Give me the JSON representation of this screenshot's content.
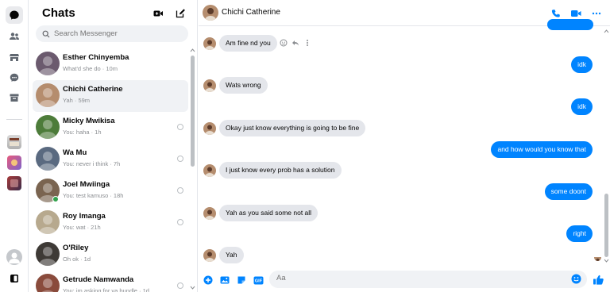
{
  "colors": {
    "accent": "#0084ff",
    "incoming_bubble": "#e4e6eb",
    "online": "#31a24c"
  },
  "rail": {
    "icons": [
      "chat-bubble-icon",
      "people-icon",
      "marketplace-icon",
      "message-request-icon",
      "archive-icon"
    ],
    "apps": [
      "app-1-icon",
      "app-2-icon",
      "app-3-icon"
    ],
    "bottom": [
      "profile-avatar",
      "sidebar-toggle-icon"
    ]
  },
  "chat_list": {
    "title": "Chats",
    "new_video_icon": "video-plus-icon",
    "compose_icon": "compose-icon",
    "search": {
      "placeholder": "Search Messenger",
      "value": ""
    },
    "items": [
      {
        "name": "Esther Chinyemba",
        "preview": "What'd she do · 10m",
        "active": false,
        "online": false,
        "read_receipt": false,
        "avatar_color": "#6b5a6e"
      },
      {
        "name": "Chichi Catherine",
        "preview": "Yah · 59m",
        "active": true,
        "online": false,
        "read_receipt": false,
        "avatar_color": "#b58d6e"
      },
      {
        "name": "Micky Mwikisa",
        "preview": "You: haha · 1h",
        "active": false,
        "online": false,
        "read_receipt": true,
        "avatar_color": "#4d7c3a"
      },
      {
        "name": "Wa Mu",
        "preview": "You: never i think · 7h",
        "active": false,
        "online": false,
        "read_receipt": true,
        "avatar_color": "#5a6a80"
      },
      {
        "name": "Joel Mwiinga",
        "preview": "You: test kamuso · 18h",
        "active": false,
        "online": true,
        "read_receipt": true,
        "avatar_color": "#7a6450"
      },
      {
        "name": "Roy Imanga",
        "preview": "You: wat · 21h",
        "active": false,
        "online": false,
        "read_receipt": true,
        "avatar_color": "#b7a98e"
      },
      {
        "name": "O'Riley",
        "preview": "Oh ok · 1d",
        "active": false,
        "online": false,
        "read_receipt": false,
        "avatar_color": "#3e3a36"
      },
      {
        "name": "Getrude Namwanda",
        "preview": "You: im asking for ya bundle · 1d",
        "active": false,
        "online": false,
        "read_receipt": true,
        "avatar_color": "#8a4b3c"
      }
    ]
  },
  "conversation": {
    "contact_name": "Chichi Catherine",
    "header_icons": [
      "phone-icon",
      "video-call-icon",
      "more-options-icon"
    ],
    "messages": [
      {
        "dir": "in",
        "text": "Am fine nd you"
      },
      {
        "dir": "out",
        "text": "idk"
      },
      {
        "dir": "in",
        "text": "Wats wrong"
      },
      {
        "dir": "out",
        "text": "idk"
      },
      {
        "dir": "in",
        "text": "Okay just know everything is going to be fine"
      },
      {
        "dir": "out",
        "text": "and how would you know that"
      },
      {
        "dir": "in",
        "text": "I just know every prob has a solution"
      },
      {
        "dir": "out",
        "text": "some doont"
      },
      {
        "dir": "in",
        "text": "Yah as you said some not all"
      },
      {
        "dir": "out",
        "text": "right"
      },
      {
        "dir": "in",
        "text": "Yah"
      }
    ],
    "composer": {
      "icons": [
        "plus-circle-icon",
        "image-icon",
        "sticker-icon",
        "gif-icon"
      ],
      "placeholder": "Aa",
      "value": "",
      "emoji_icon": "emoji-icon",
      "like_icon": "thumbs-up-icon"
    }
  }
}
